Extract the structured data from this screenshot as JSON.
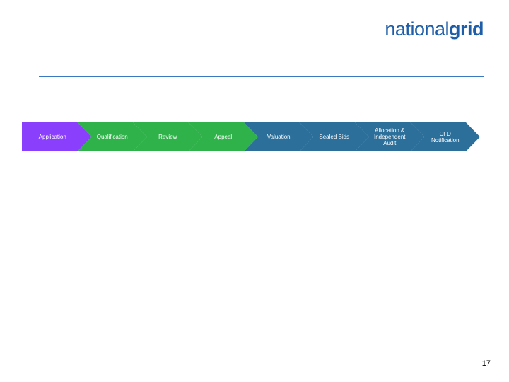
{
  "logo": {
    "part1": "national",
    "part2": "grid"
  },
  "steps": [
    {
      "label": "Application",
      "color": "#8a3ffc"
    },
    {
      "label": "Qualification",
      "color": "#2fb24a"
    },
    {
      "label": "Review",
      "color": "#2fb24a"
    },
    {
      "label": "Appeal",
      "color": "#2fb24a"
    },
    {
      "label": "Valuation",
      "color": "#2b6f9a"
    },
    {
      "label": "Sealed Bids",
      "color": "#2b6f9a"
    },
    {
      "label": "Allocation &\nIndependent\nAudit",
      "color": "#2b6f9a"
    },
    {
      "label": "CFD\nNotification",
      "color": "#2b6f9a"
    }
  ],
  "page_number": "17"
}
